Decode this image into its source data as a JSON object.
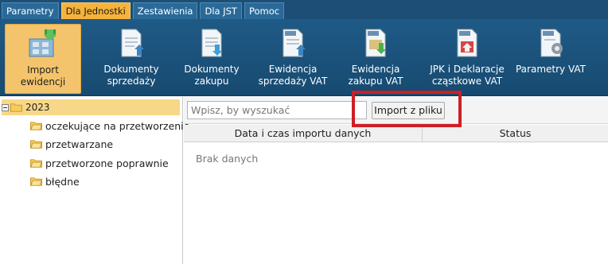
{
  "menu": {
    "tabs": [
      {
        "label": "Parametry"
      },
      {
        "label": "Dla Jednostki"
      },
      {
        "label": "Zestawienia"
      },
      {
        "label": "Dla JST"
      },
      {
        "label": "Pomoc"
      }
    ],
    "active_tab": "Dla Jednostki"
  },
  "ribbon": {
    "buttons": [
      {
        "label": "Import ewidencji",
        "icon": "import-icon"
      },
      {
        "label": "Dokumenty sprzedaży",
        "icon": "document-sales-icon"
      },
      {
        "label": "Dokumenty zakupu",
        "icon": "document-purchase-icon"
      },
      {
        "label": "Ewidencja sprzedaży VAT",
        "icon": "vat-sales-register-icon"
      },
      {
        "label": "Ewidencja zakupu VAT",
        "icon": "vat-purchase-register-icon"
      },
      {
        "label": "JPK i Deklaracje cząstkowe VAT",
        "icon": "jpk-declaration-icon"
      },
      {
        "label": "Parametry VAT",
        "icon": "vat-settings-icon"
      }
    ],
    "active": "Import ewidencji"
  },
  "tree": {
    "root": "2023",
    "items": [
      {
        "label": "oczekujące na przetworzenie"
      },
      {
        "label": "przetwarzane"
      },
      {
        "label": "przetworzone poprawnie"
      },
      {
        "label": "błędne"
      }
    ]
  },
  "main": {
    "search_placeholder": "Wpisz, by wyszukać",
    "import_button": "Import z pliku",
    "columns": [
      "Data i czas importu danych",
      "Status"
    ],
    "empty_text": "Brak danych"
  },
  "colors": {
    "menubar": "#1d4f76",
    "ribbon": "#1f5a86",
    "active_tab": "#f6b33b",
    "highlight": "#cc1f25",
    "tree_selected": "#f7d888"
  }
}
